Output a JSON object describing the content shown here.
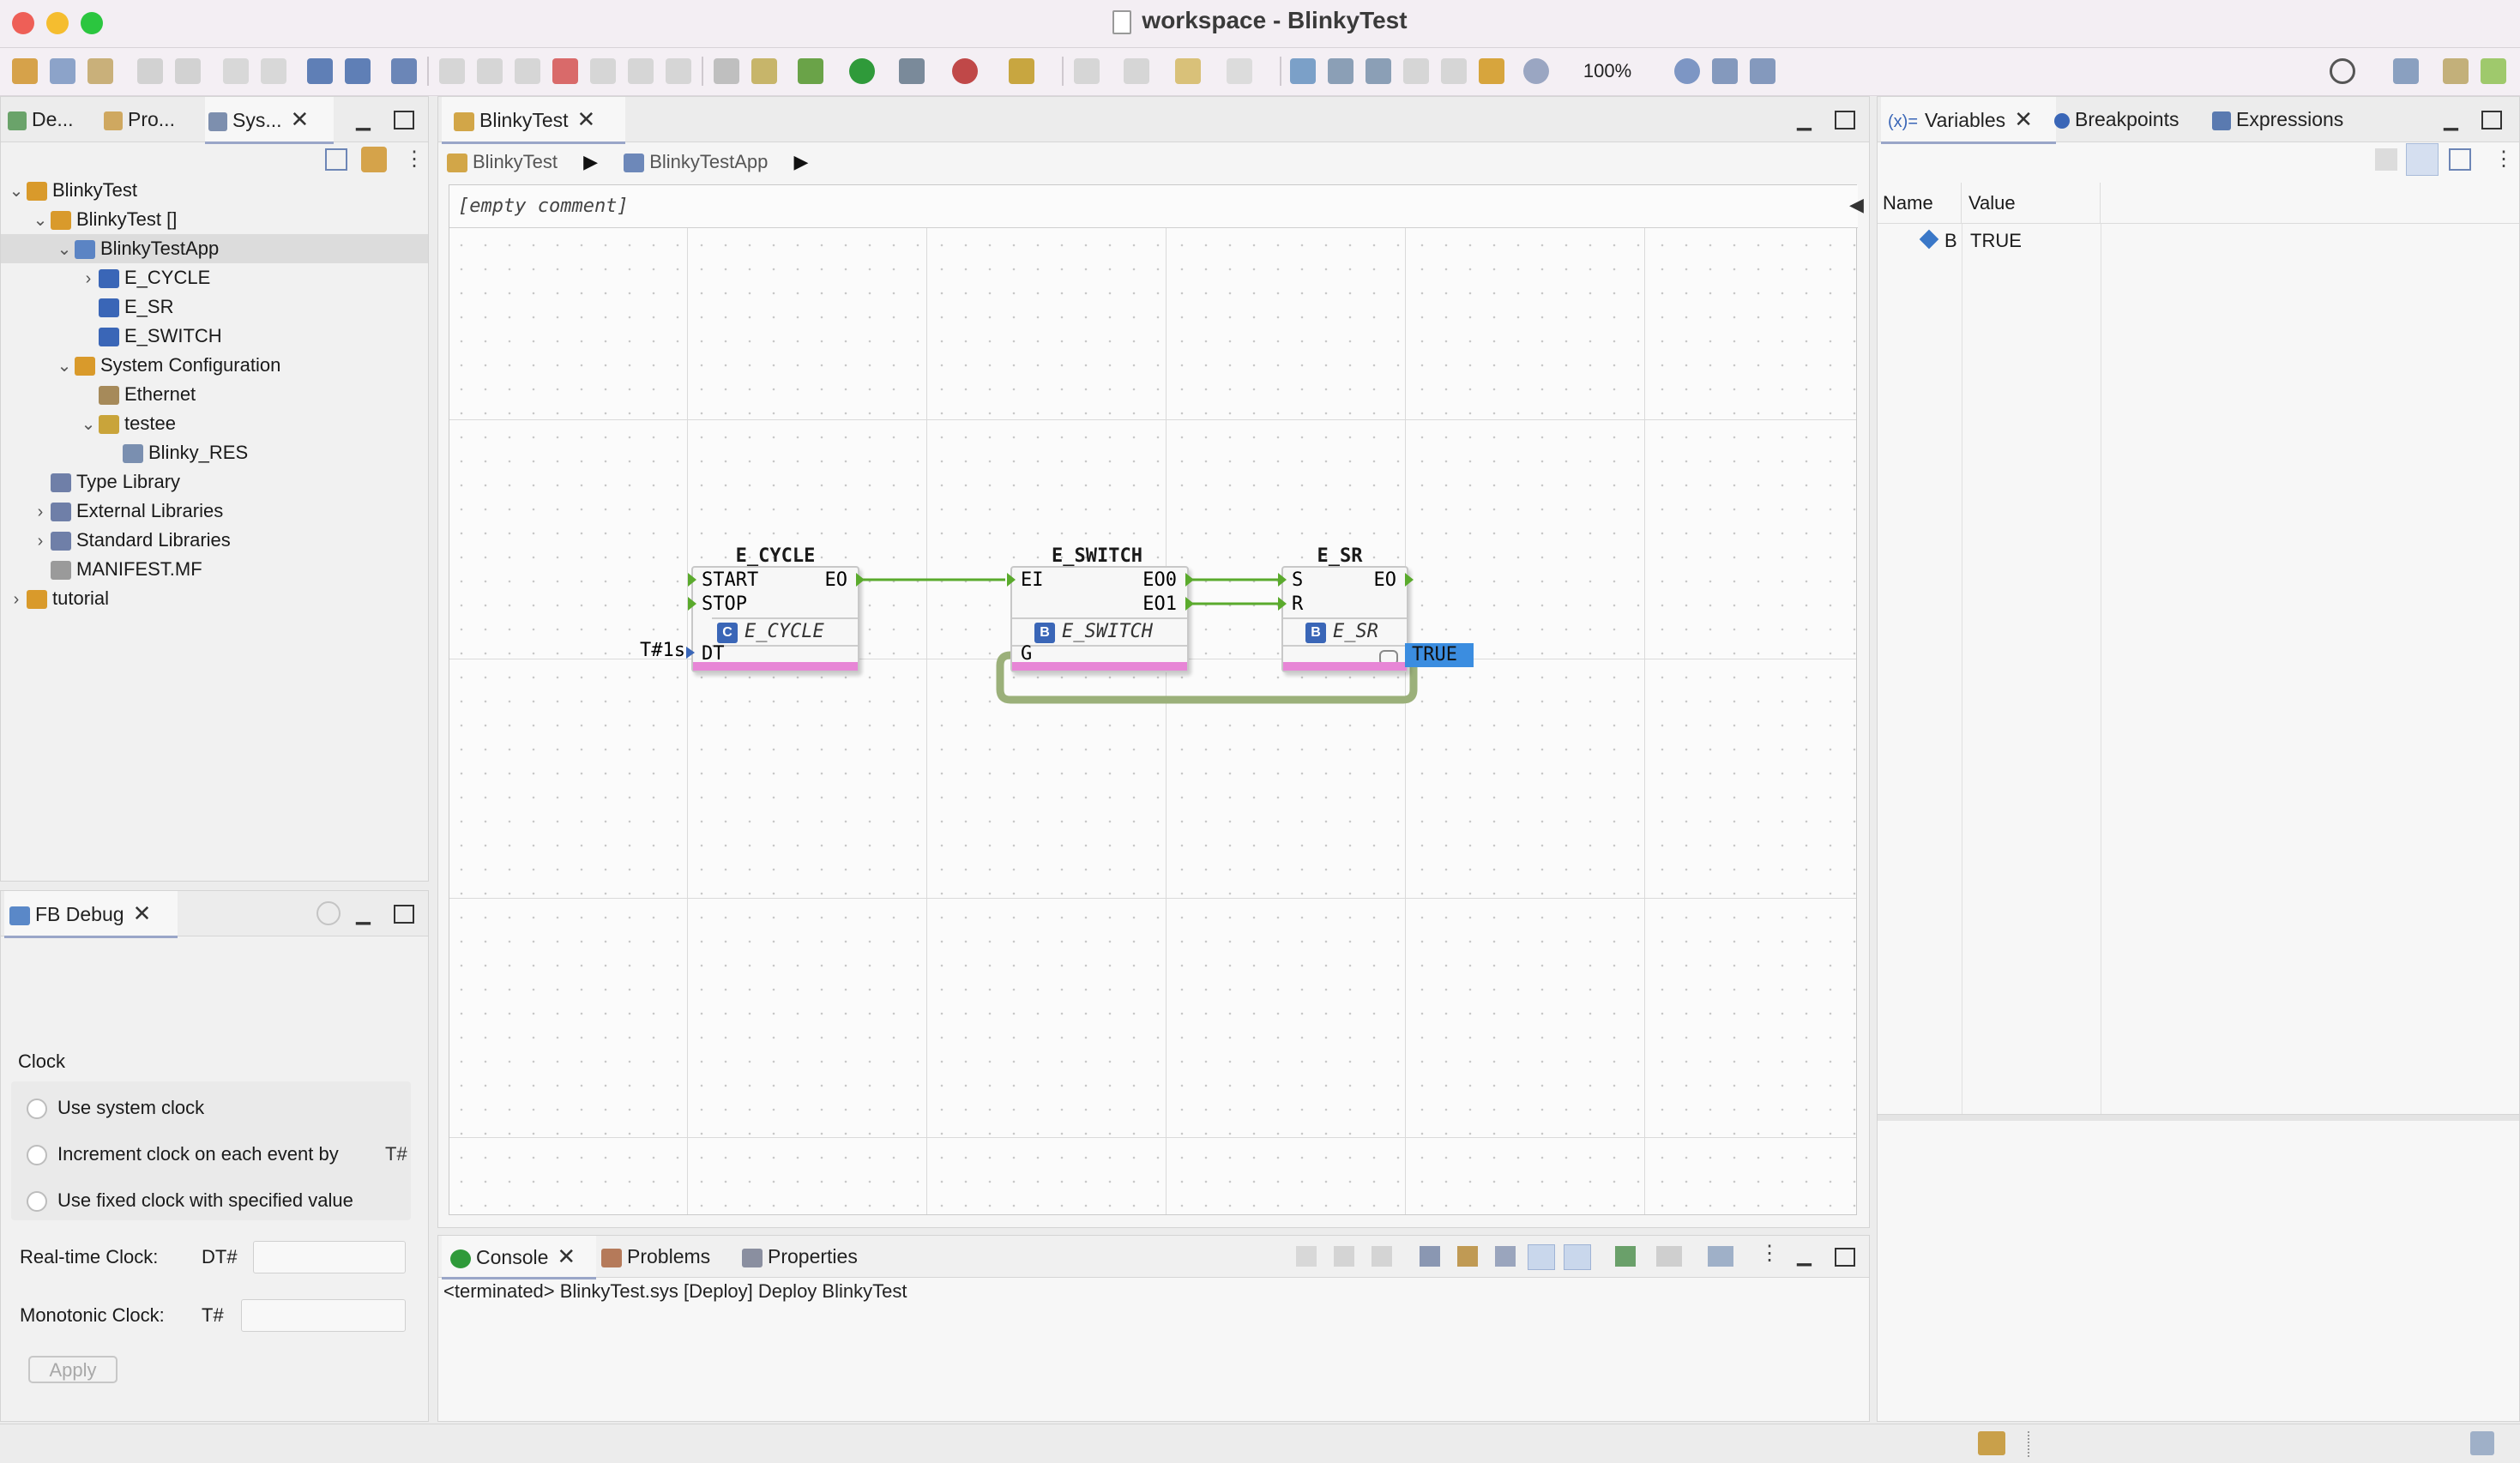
{
  "window": {
    "title": "workspace - BlinkyTest"
  },
  "toolbar": {
    "zoom": "100%"
  },
  "left_panel": {
    "tabs": [
      "De...",
      "Pro...",
      "Sys..."
    ],
    "tree": [
      {
        "label": "BlinkyTest",
        "indent": 0,
        "chev": "v",
        "icon": "#d99a2b"
      },
      {
        "label": "BlinkyTest []",
        "indent": 1,
        "chev": "v",
        "icon": "#d99a2b"
      },
      {
        "label": "BlinkyTestApp",
        "indent": 2,
        "chev": "v",
        "icon": "#5b84c4",
        "selected": true
      },
      {
        "label": "E_CYCLE",
        "indent": 3,
        "chev": ">",
        "icon": "#3a66b7"
      },
      {
        "label": "E_SR",
        "indent": 3,
        "chev": "",
        "icon": "#3a66b7"
      },
      {
        "label": "E_SWITCH",
        "indent": 3,
        "chev": "",
        "icon": "#3a66b7"
      },
      {
        "label": "System Configuration",
        "indent": 2,
        "chev": "v",
        "icon": "#d99a2b"
      },
      {
        "label": "Ethernet",
        "indent": 3,
        "chev": "",
        "icon": "#a68a5a"
      },
      {
        "label": "testee",
        "indent": 3,
        "chev": "v",
        "icon": "#c9a43a"
      },
      {
        "label": "Blinky_RES",
        "indent": 4,
        "chev": "",
        "icon": "#7a8fb0"
      },
      {
        "label": "Type Library",
        "indent": 1,
        "chev": "",
        "icon": "#6f7fa8"
      },
      {
        "label": "External Libraries",
        "indent": 1,
        "chev": ">",
        "icon": "#6f7fa8"
      },
      {
        "label": "Standard Libraries",
        "indent": 1,
        "chev": ">",
        "icon": "#6f7fa8"
      },
      {
        "label": "MANIFEST.MF",
        "indent": 1,
        "chev": "",
        "icon": "#9a9a9a"
      },
      {
        "label": "tutorial",
        "indent": 0,
        "chev": ">",
        "icon": "#d99a2b"
      }
    ]
  },
  "fb_debug": {
    "tab": "FB Debug",
    "clock_title": "Clock",
    "options": [
      "Use system clock",
      "Increment clock on each event by",
      "Use fixed clock with specified value"
    ],
    "increment_suffix": "T#",
    "realtime_label": "Real-time Clock:",
    "realtime_prefix": "DT#",
    "monotonic_label": "Monotonic Clock:",
    "monotonic_prefix": "T#",
    "apply": "Apply"
  },
  "editor": {
    "tab": "BlinkyTest",
    "breadcrumb": [
      "BlinkyTest",
      "BlinkyTestApp"
    ],
    "comment": "[empty comment]",
    "blocks": {
      "cycle": {
        "name": "E_CYCLE",
        "type": "E_CYCLE",
        "in1": "START",
        "in2": "STOP",
        "out1": "EO",
        "data_in": "DT",
        "param": "T#1s"
      },
      "switch": {
        "name": "E_SWITCH",
        "type": "E_SWITCH",
        "in1": "EI",
        "out1": "EO0",
        "out2": "EO1",
        "data_in": "G"
      },
      "sr": {
        "name": "E_SR",
        "type": "E_SR",
        "in1": "S",
        "in2": "R",
        "out1": "EO",
        "watch": "TRUE"
      }
    }
  },
  "bottom_panel": {
    "tabs": [
      "Console",
      "Problems",
      "Properties"
    ],
    "console_line": "<terminated> BlinkyTest.sys [Deploy] Deploy BlinkyTest"
  },
  "right_panel": {
    "tabs": [
      "Variables",
      "Breakpoints",
      "Expressions"
    ],
    "tab_prefix": "(x)=",
    "columns": [
      "Name",
      "Value"
    ],
    "rows": [
      {
        "name": "B",
        "value": "TRUE"
      }
    ]
  },
  "colors": {
    "connection": "#5aaa2c",
    "data_conn": "#9bb07a",
    "pink": "#e786d6",
    "highlight": "#3b8de0"
  }
}
